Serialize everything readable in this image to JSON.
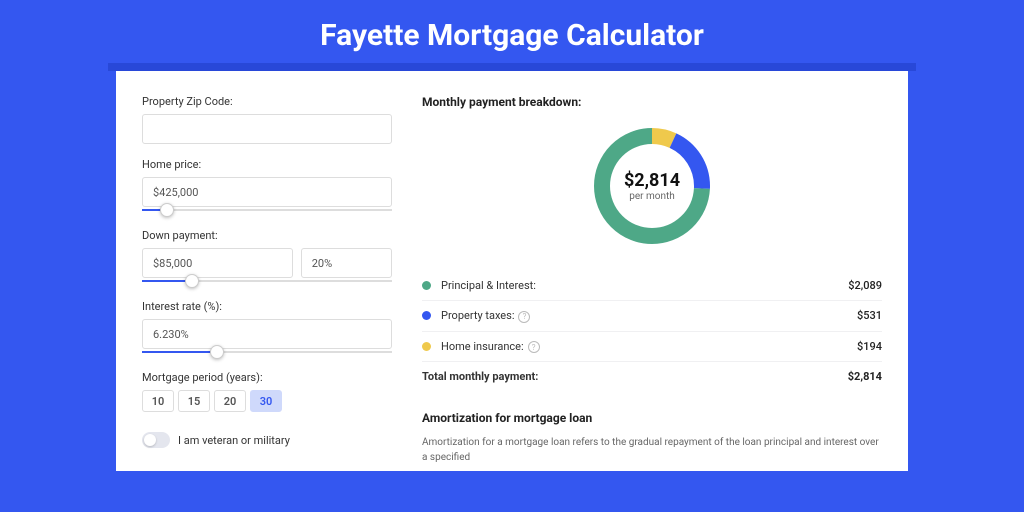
{
  "header": {
    "title": "Fayette Mortgage Calculator"
  },
  "form": {
    "zip": {
      "label": "Property Zip Code:",
      "value": ""
    },
    "homePrice": {
      "label": "Home price:",
      "value": "$425,000",
      "sliderPercent": 10
    },
    "downPayment": {
      "label": "Down payment:",
      "value": "$85,000",
      "percent": "20%",
      "sliderPercent": 20
    },
    "interestRate": {
      "label": "Interest rate (%):",
      "value": "6.230%",
      "sliderPercent": 30
    },
    "period": {
      "label": "Mortgage period (years):",
      "options": [
        "10",
        "15",
        "20",
        "30"
      ],
      "active": "30"
    },
    "veteran": {
      "label": "I am veteran or military",
      "checked": false
    }
  },
  "breakdown": {
    "title": "Monthly payment breakdown:",
    "donut": {
      "value": "$2,814",
      "sub": "per month"
    },
    "items": [
      {
        "color": "#4ea887",
        "label": "Principal & Interest:",
        "value": "$2,089",
        "info": false
      },
      {
        "color": "#3457f0",
        "label": "Property taxes:",
        "value": "$531",
        "info": true
      },
      {
        "color": "#efc94c",
        "label": "Home insurance:",
        "value": "$194",
        "info": true
      }
    ],
    "total": {
      "label": "Total monthly payment:",
      "value": "$2,814"
    }
  },
  "chart_data": {
    "type": "pie",
    "title": "Monthly payment breakdown",
    "categories": [
      "Principal & Interest",
      "Property taxes",
      "Home insurance"
    ],
    "values": [
      2089,
      531,
      194
    ],
    "colors": [
      "#4ea887",
      "#3457f0",
      "#efc94c"
    ],
    "total": 2814
  },
  "amort": {
    "title": "Amortization for mortgage loan",
    "text": "Amortization for a mortgage loan refers to the gradual repayment of the loan principal and interest over a specified"
  }
}
